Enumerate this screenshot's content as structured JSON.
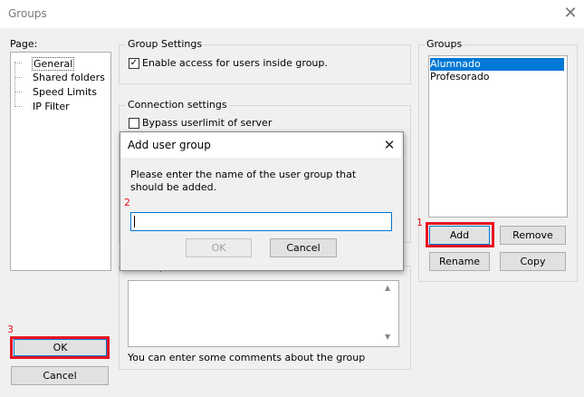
{
  "window": {
    "title": "Groups",
    "close_icon": "close-icon"
  },
  "page_panel": {
    "label": "Page:",
    "items": [
      "General",
      "Shared folders",
      "Speed Limits",
      "IP Filter"
    ]
  },
  "group_settings": {
    "legend": "Group Settings",
    "enable_access_label": "Enable access for users inside group.",
    "enable_access_checked": true
  },
  "connection_settings": {
    "legend": "Connection settings",
    "bypass_label": "Bypass userlimit of server",
    "bypass_checked": false
  },
  "description": {
    "legend": "Description",
    "help_text": "You can enter some comments about the group"
  },
  "groups_panel": {
    "legend": "Groups",
    "items": [
      {
        "label": "Alumnado",
        "selected": true
      },
      {
        "label": "Profesorado",
        "selected": false
      }
    ]
  },
  "buttons": {
    "add": "Add",
    "remove": "Remove",
    "rename": "Rename",
    "copy": "Copy",
    "ok": "OK",
    "cancel": "Cancel"
  },
  "annotations": {
    "n1": "1",
    "n2": "2",
    "n3": "3",
    "highlight_color": "#e8141f"
  },
  "dialog": {
    "title": "Add user group",
    "message": "Please enter the name of the user group that should be added.",
    "input_value": "",
    "ok_label": "OK",
    "cancel_label": "Cancel",
    "ok_enabled": false
  }
}
